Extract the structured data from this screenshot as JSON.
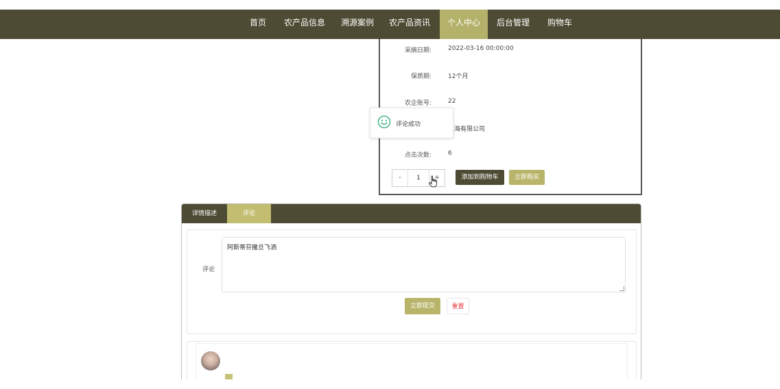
{
  "nav": {
    "items": [
      "首页",
      "农产品信息",
      "溯源案例",
      "农产品资讯",
      "个人中心",
      "后台管理",
      "购物车"
    ],
    "active_index": 4,
    "bg_color": "#4d4b33",
    "active_color": "#b4b26a"
  },
  "detail": {
    "rows": [
      {
        "label": "采摘日期:",
        "value": "2022-03-16 00:00:00"
      },
      {
        "label": "保质期:",
        "value": "12个月"
      },
      {
        "label": "农企账号:",
        "value": "22"
      },
      {
        "label": "",
        "value": "上海有限公司"
      },
      {
        "label": "点击次数:",
        "value": "6"
      }
    ],
    "quantity": {
      "minus": "-",
      "value": "1",
      "plus": "+"
    },
    "add_to_cart": "添加到购物车",
    "buy_now": "立即购买"
  },
  "toast": {
    "text": "评论成功",
    "icon": "smiley-icon"
  },
  "panel": {
    "tabs": [
      "详情描述",
      "评论"
    ],
    "active_tab": 1,
    "comment_label": "评论",
    "comment_value": "阿斯蒂芬撒旦飞洒",
    "submit": "立即提交",
    "reset": "重置"
  },
  "colors": {
    "dark": "#4d4b33",
    "accent": "#b8b46a",
    "reset_text": "#e4393c"
  }
}
